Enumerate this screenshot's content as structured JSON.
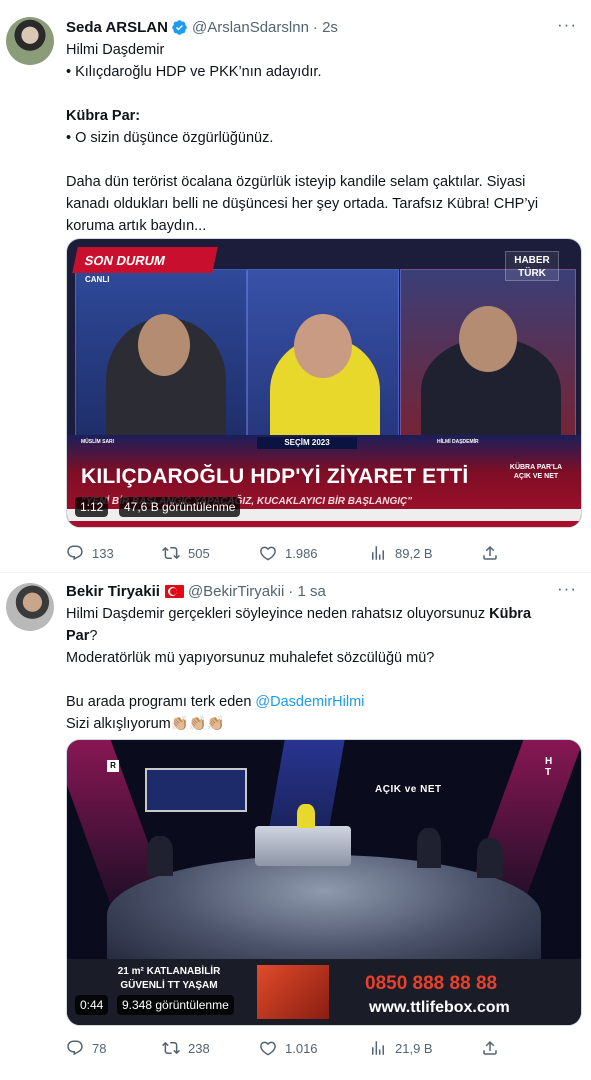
{
  "tweet1": {
    "name": "Seda ARSLAN",
    "handle": "@ArslanSdarslnn",
    "time": "· 2s",
    "more": "···",
    "lines": [
      "Hilmi Daşdemir",
      "• Kılıçdaroğlu HDP ve PKK’nın adayıdır.",
      "",
      "Kübra Par:",
      "• O sizin düşünce özgürlüğünüz.",
      "",
      "Daha dün terörist öcalana özgürlük isteyip kandile selam çaktılar. Siyasi",
      "kanadı oldukları belli ne düşüncesi her şey ortada. Tarafsız Kübra! CHP’yi",
      "koruma artık baydın..."
    ],
    "video": {
      "banner": "SON DURUM",
      "live": "CANLI",
      "channel_logo": "HABER TÜRK",
      "left_caption": "MÜSLİM SARI",
      "right_caption": "HİLMİ DAŞDEMİR",
      "election": "SEÇİM 2023",
      "headline": "KILIÇDAROĞLU HDP'Yİ ZİYARET ETTİ",
      "show": "KÜBRA PAR'LA AÇIK VE NET",
      "ticker": "\"YENİ BİR BAŞLANGIÇ YAPACAĞIZ, KUCAKLAYICI BİR BAŞLANGIÇ\"",
      "duration": "1:12",
      "views": "47,6 B görüntülenme"
    },
    "actions": {
      "replies": "133",
      "retweets": "505",
      "likes": "1.986",
      "views": "89,2 B"
    }
  },
  "tweet2": {
    "name": "Bekir Tiryakii",
    "handle": "@BekirTiryakii",
    "time": "· 1 sa",
    "more": "···",
    "line1a": "Hilmi Daşdemir gerçekleri söyleyince neden rahatsız oluyorsunuz ",
    "line1b": "Kübra",
    "line2a": "Par",
    "line2b": "?",
    "line3": "Moderatörlük mü yapıyorsunuz muhalefet sözcülüğü mü?",
    "line4a": "Bu arada programı terk eden ",
    "mention": "@DasdemirHilmi",
    "line5": "Sizi alkışlıyorum👏🏼👏🏼👏🏼",
    "video": {
      "show": "AÇIK ve NET",
      "channel_logo": "H T",
      "corner": "R",
      "ad_left": "21 m² KATLANABİLİR GÜVENLİ TT YAŞAM",
      "ad_phone": "0850 888 88 88",
      "ad_url": "www.ttlifebox.com",
      "duration": "0:44",
      "views": "9.348 görüntülenme"
    },
    "actions": {
      "replies": "78",
      "retweets": "238",
      "likes": "1.016",
      "views": "21,9 B"
    }
  },
  "colors": {
    "verified": "#1d9bf0",
    "mention": "#1d9bf0",
    "muted": "#536471"
  }
}
